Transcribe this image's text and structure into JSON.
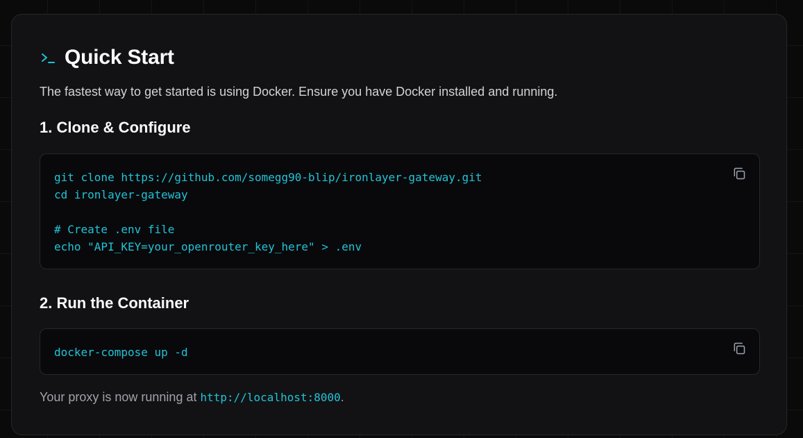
{
  "section": {
    "title": "Quick Start",
    "title_icon": "terminal-icon",
    "intro": "The fastest way to get started is using Docker. Ensure you have Docker installed and running."
  },
  "steps": [
    {
      "heading": "1. Clone & Configure",
      "code_lines": [
        "git clone https://github.com/somegg90-blip/ironlayer-gateway.git",
        "cd ironlayer-gateway",
        "",
        "# Create .env file",
        "echo \"API_KEY=your_openrouter_key_here\" > .env"
      ],
      "copy_icon": "copy-icon"
    },
    {
      "heading": "2. Run the Container",
      "code_lines": [
        "docker-compose up -d"
      ],
      "copy_icon": "copy-icon"
    }
  ],
  "footer": {
    "prefix": "Your proxy is now running at ",
    "link": "http://localhost:8000",
    "suffix": "."
  },
  "colors": {
    "background": "#0a0a0b",
    "card": "#121214",
    "code_background": "#09090b",
    "accent": "#22c3d8",
    "border": "#27272a"
  }
}
